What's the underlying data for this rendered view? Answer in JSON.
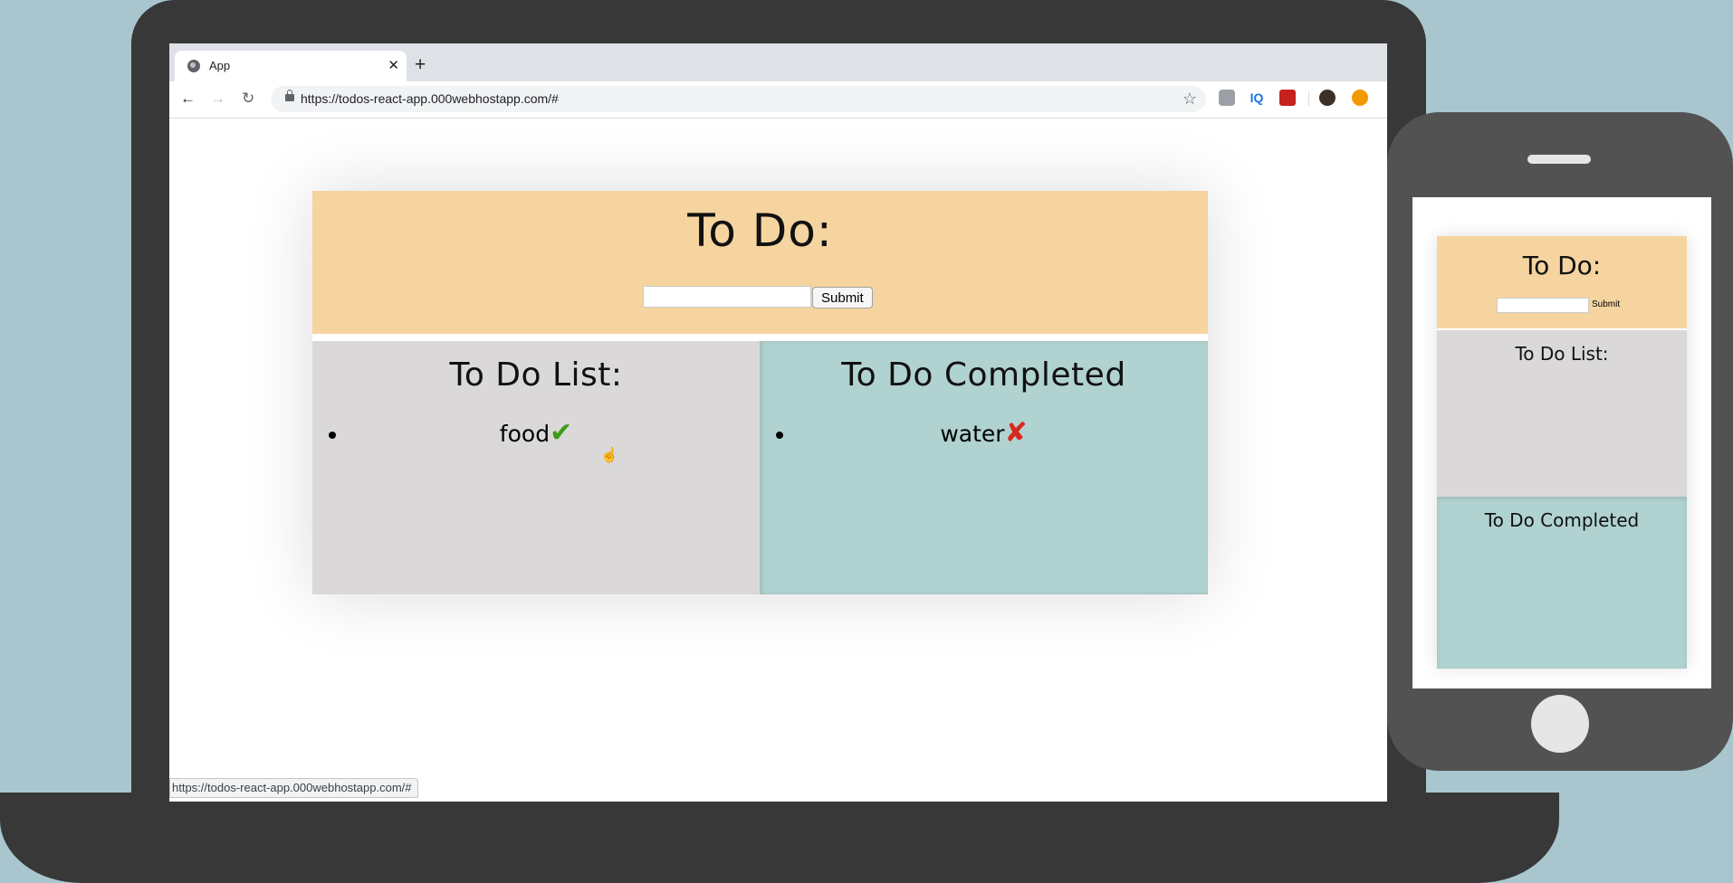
{
  "browser": {
    "tab_title": "App",
    "tab_close": "✕",
    "new_tab": "+",
    "url": "https://todos-react-app.000webhostapp.com/#",
    "status_url": "https://todos-react-app.000webhostapp.com/#",
    "ext_iq": "IQ"
  },
  "app": {
    "title": "To Do:",
    "input_value": "",
    "submit_label": "Submit",
    "todo_list_title": "To Do List:",
    "todo_items": [
      {
        "text": "food",
        "action_icon": "✔"
      }
    ],
    "completed_title": "To Do Completed",
    "completed_items": [
      {
        "text": "water",
        "action_icon": "✘"
      }
    ]
  },
  "phone_app": {
    "title": "To Do:",
    "submit_label": "Submit",
    "todo_list_title": "To Do List:",
    "completed_title": "To Do Completed"
  },
  "colors": {
    "header_bg": "#f5d4a0",
    "todo_bg": "#dad8d9",
    "completed_bg": "#b0d2d0",
    "check_green": "#3c9b16",
    "cross_red": "#d8281d",
    "device_frame": "#383838",
    "backdrop": "#a9c6cf"
  }
}
